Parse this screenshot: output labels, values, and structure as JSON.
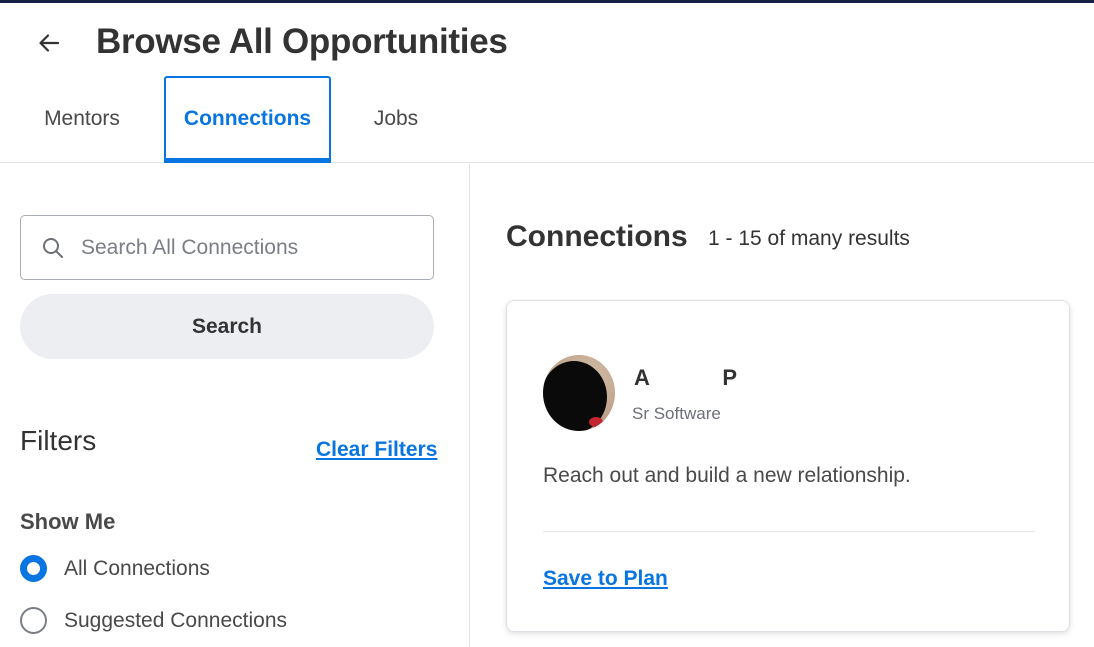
{
  "header": {
    "title": "Browse All Opportunities",
    "back_icon": "arrow-left-icon"
  },
  "tabs": [
    {
      "label": "Mentors",
      "selected": false
    },
    {
      "label": "Connections",
      "selected": true
    },
    {
      "label": "Jobs",
      "selected": false
    }
  ],
  "sidebar": {
    "search": {
      "placeholder": "Search All Connections",
      "value": "",
      "icon": "search-icon"
    },
    "search_button_label": "Search",
    "filters_heading": "Filters",
    "clear_filters_label": "Clear Filters",
    "show_me": {
      "label": "Show Me",
      "options": [
        {
          "label": "All Connections",
          "selected": true
        },
        {
          "label": "Suggested Connections",
          "selected": false
        }
      ]
    }
  },
  "results": {
    "heading": "Connections",
    "count_text": "1 - 15 of many results",
    "cards": [
      {
        "name": "A            P",
        "title": "Sr Software",
        "description": "Reach out and build a new relationship.",
        "action_label": "Save to Plan"
      }
    ]
  },
  "colors": {
    "accent": "#0875e1",
    "top_bar": "#1a1f4a",
    "text": "#333333"
  }
}
